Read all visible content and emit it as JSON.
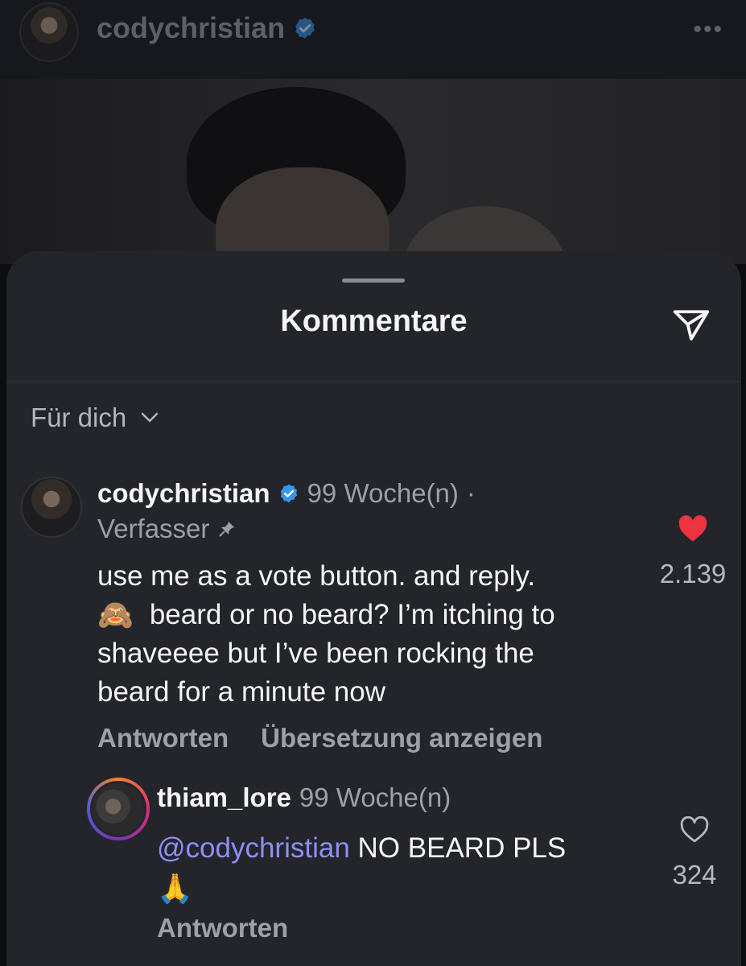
{
  "header": {
    "username": "codychristian",
    "more_icon": "more-horizontal-icon"
  },
  "sheet": {
    "title": "Kommentare",
    "send_icon": "send-icon"
  },
  "filter": {
    "label": "Für dich"
  },
  "comment": {
    "username": "codychristian",
    "time": "99 Woche(n)",
    "separator": "·",
    "author_badge": "Verfasser",
    "text_line1": "use me as a vote button. and reply.",
    "emoji": "🙈",
    "text_line2": "beard or no beard? I’m itching to",
    "text_line3": "shaveeee but I’ve been rocking the",
    "text_line4": "beard for a minute now",
    "reply_label": "Antworten",
    "translate_label": "Übersetzung anzeigen",
    "likes": "2.139",
    "liked": true,
    "heart_color": "#ef3340"
  },
  "reply": {
    "username": "thiam_lore",
    "time": "99 Woche(n)",
    "mention": "@codychristian",
    "text": "NO BEARD PLS",
    "emoji": "🙏",
    "reply_label": "Antworten",
    "likes": "324",
    "liked": false
  },
  "colors": {
    "sheet_bg": "#23252b",
    "verified": "#3797f0",
    "mention": "#8f8ff7"
  }
}
